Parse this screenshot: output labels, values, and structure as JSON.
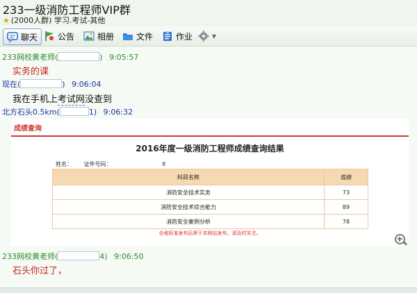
{
  "window": {
    "title": "233一级消防工程师VIP群",
    "subtitle": "(2000人群) 学习.考试-其他"
  },
  "toolbar": {
    "chat": "聊天",
    "notice": "公告",
    "album": "相册",
    "files": "文件",
    "homework": "作业"
  },
  "messages": [
    {
      "sender_prefix": "233网校黄老师(",
      "sender_suffix": ")",
      "time": "9:05:57",
      "text": "实务的课"
    },
    {
      "sender_prefix": "现在(",
      "sender_suffix": ")",
      "time": "9:06:04",
      "text_a": "我在手机上",
      "text_b": "考试网",
      "text_c": "没查到"
    },
    {
      "sender_prefix": "北方石头0.5km(",
      "sender_suffix": "1)",
      "time": "9:06:32"
    },
    {
      "sender_prefix": "233网校黄老师(",
      "sender_suffix": "4)",
      "time": "9:06:50",
      "text": "石头你过了，"
    }
  ],
  "screenshot": {
    "header": "成绩查询",
    "title": "2016年度一级消防工程师成绩查询结果",
    "name_label": "姓名：",
    "id_label": "证件号码：",
    "id_tail": "8",
    "col_subject": "科目名称",
    "col_score": "成绩",
    "rows": [
      {
        "subject": "消防安全技术实务",
        "score": "73"
      },
      {
        "subject": "消防安全技术综合能力",
        "score": "89"
      },
      {
        "subject": "消防安全案例分析",
        "score": "78"
      }
    ],
    "note": "合格标准发布后将于本网站发布，请及时关注。"
  }
}
